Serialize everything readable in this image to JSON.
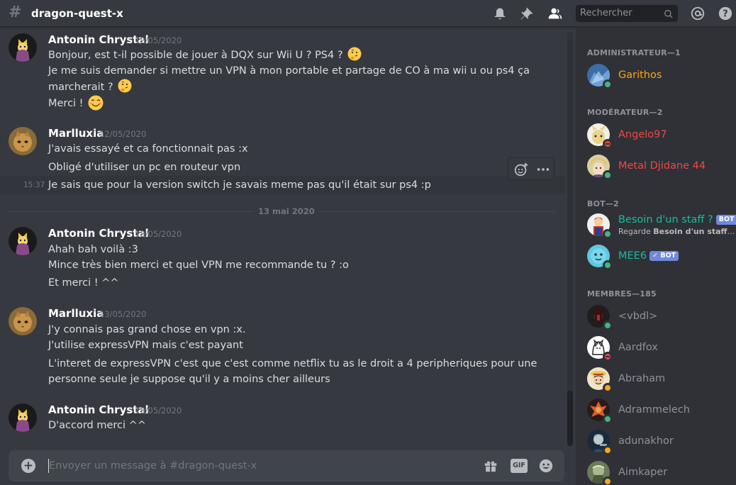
{
  "header": {
    "channel_name": "dragon-quest-x",
    "search_placeholder": "Rechercher",
    "icons": [
      "bell-icon",
      "pin-icon",
      "members-icon",
      "search-icon",
      "mention-icon",
      "help-icon"
    ]
  },
  "messages": [
    {
      "author": "Antonin Chrystal",
      "timestamp": "12/05/2020",
      "lines": [
        "Bonjour, est t-il possible de jouer à DQX sur Wii U ? PS4 ?",
        "Je me suis demander si mettre un VPN à mon portable et partage de CO à ma wii u ou ps4 ça",
        "marcherait ?",
        "Merci !"
      ]
    },
    {
      "author": "Marlluxia",
      "timestamp": "12/05/2020",
      "lines": [
        "J'avais essayé et ca fonctionnait pas :x",
        "Obligé d'utiliser un pc en routeur vpn",
        "Je sais que pour la version switch je savais meme pas qu'il était sur ps4 :p"
      ],
      "hover_time": "15:37"
    },
    {
      "author": "Antonin Chrystal",
      "timestamp": "13/05/2020",
      "lines": [
        "Ahah bah voilà :3",
        "Mince très bien merci et quel VPN me recommande tu ? :o",
        "Et merci ! ^^"
      ]
    },
    {
      "author": "Marlluxia",
      "timestamp": "13/05/2020",
      "lines": [
        "J'y connais pas grand chose en vpn :x.",
        "J'utilise expressVPN mais c'est payant",
        "L'interet de expressVPN c'est que c'est  comme netflix tu as le droit a 4 peripheriques pour une",
        "personne seule je suppose qu'il y a moins cher ailleurs"
      ]
    },
    {
      "author": "Antonin Chrystal",
      "timestamp": "13/05/2020",
      "lines": [
        "D'accord merci ^^"
      ]
    }
  ],
  "date_divider": "13 mai 2020",
  "composer": {
    "placeholder": "Envoyer un message à #dragon-quest-x",
    "gif_label": "GIF"
  },
  "members": {
    "groups": [
      {
        "title": "ADMINISTRATEUR—1",
        "items": [
          {
            "name": "Garithos",
            "color": "#faa61a",
            "status": "online"
          }
        ]
      },
      {
        "title": "MODÉRATEUR—2",
        "items": [
          {
            "name": "Angelo97",
            "color": "#f04747",
            "status": "dnd"
          },
          {
            "name": "Metal Djidane 44",
            "color": "#f04747",
            "status": "online"
          }
        ]
      },
      {
        "title": "BOT—2",
        "items": [
          {
            "name": "Besoin d'un staff ?",
            "color": "#1abc9c",
            "status": "online",
            "tag": "BOT",
            "activity_prefix": "Regarde ",
            "activity": "Besoin d'un staff ? M..."
          },
          {
            "name": "MEE6",
            "color": "#1abc9c",
            "status": "online",
            "tag": "✓ BOT"
          }
        ]
      },
      {
        "title": "MEMBRES—185",
        "items": [
          {
            "name": "<vbdl>",
            "color": "#8e9297",
            "status": "online"
          },
          {
            "name": "Aardfox",
            "color": "#8e9297",
            "status": "dnd"
          },
          {
            "name": "Abraham",
            "color": "#8e9297",
            "status": "idle"
          },
          {
            "name": "Adrammelech",
            "color": "#8e9297",
            "status": "online"
          },
          {
            "name": "adunakhor",
            "color": "#8e9297",
            "status": "idle"
          },
          {
            "name": "Aimkaper",
            "color": "#8e9297",
            "status": "idle"
          }
        ]
      }
    ]
  },
  "colors": {
    "background": "#36393f",
    "sidebar": "#2f3136",
    "admin": "#faa61a",
    "moderator": "#f04747",
    "bot": "#1abc9c",
    "bot_tag": "#7289da"
  }
}
